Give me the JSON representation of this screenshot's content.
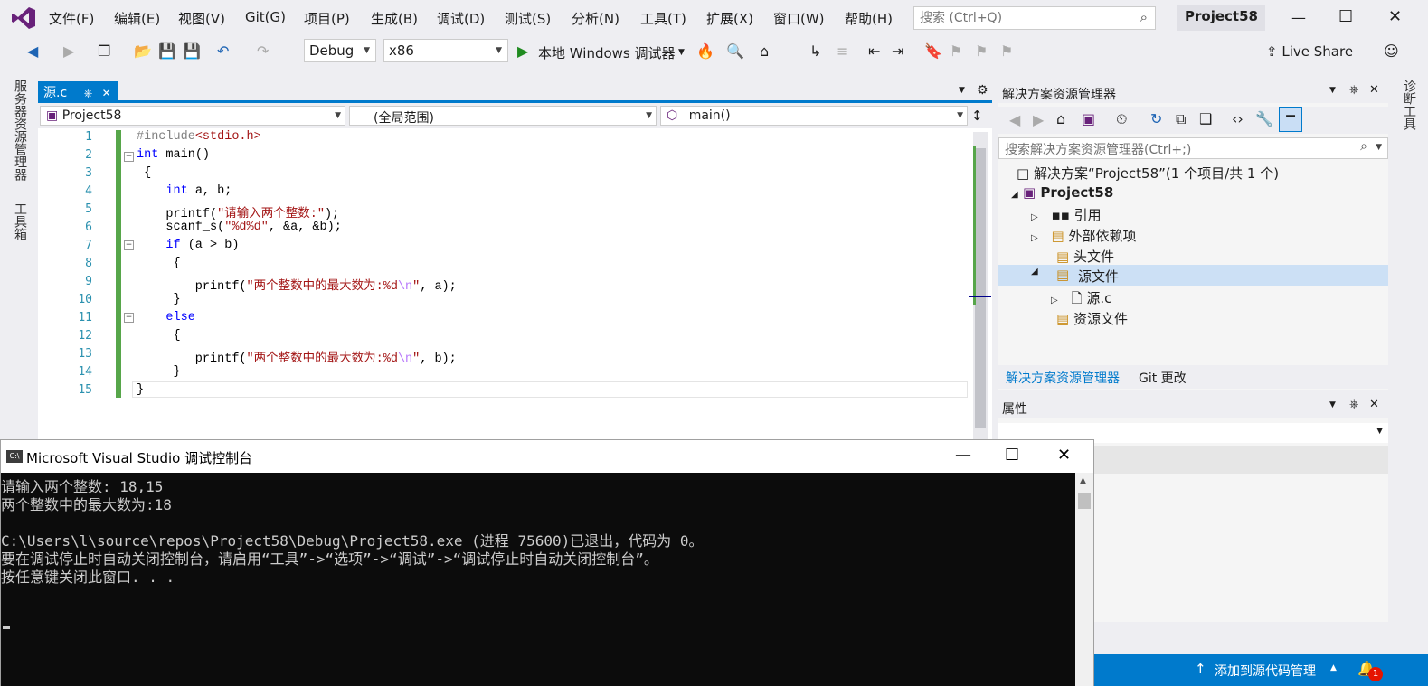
{
  "menu": [
    "文件(F)",
    "编辑(E)",
    "视图(V)",
    "Git(G)",
    "项目(P)",
    "生成(B)",
    "调试(D)",
    "测试(S)",
    "分析(N)",
    "工具(T)",
    "扩展(X)",
    "窗口(W)",
    "帮助(H)"
  ],
  "search": {
    "placeholder": "搜索 (Ctrl+Q)"
  },
  "project_name": "Project58",
  "toolbar": {
    "config": "Debug",
    "platform": "x86",
    "run_label": "本地 Windows 调试器",
    "live_share": "Live Share"
  },
  "left_tabs": [
    "服务器资源管理器",
    "工具箱"
  ],
  "right_tab": "诊断工具",
  "editor": {
    "tab_label": "源.c",
    "nav": {
      "project": "Project58",
      "scope": "(全局范围)",
      "member": "main()"
    },
    "lines": [
      "1",
      "2",
      "3",
      "4",
      "5",
      "6",
      "7",
      "8",
      "9",
      "10",
      "11",
      "12",
      "13",
      "14",
      "15"
    ]
  },
  "solution_explorer": {
    "title": "解决方案资源管理器",
    "search_placeholder": "搜索解决方案资源管理器(Ctrl+;)",
    "solution": "解决方案“Project58”(1 个项目/共 1 个)",
    "project": "Project58",
    "items": [
      "引用",
      "外部依赖项",
      "头文件",
      "源文件",
      "源.c",
      "资源文件"
    ],
    "tabs": [
      "解决方案资源管理器",
      "Git 更改"
    ]
  },
  "properties": {
    "title": "属性"
  },
  "status": {
    "source_control": "添加到源代码管理",
    "notifications": "1"
  },
  "console": {
    "title": "Microsoft Visual Studio 调试控制台",
    "lines": [
      "请输入两个整数: 18,15",
      "两个整数中的最大数为:18",
      "",
      "C:\\Users\\l\\source\\repos\\Project58\\Debug\\Project58.exe (进程 75600)已退出，代码为 0。",
      "要在调试停止时自动关闭控制台，请启用“工具”->“选项”->“调试”->“调试停止时自动关闭控制台”。",
      "按任意键关闭此窗口. . ."
    ]
  },
  "colors": {
    "accent": "#007acc",
    "keyword": "#0000ff",
    "string": "#a31515",
    "change_bar": "#57a64a"
  }
}
